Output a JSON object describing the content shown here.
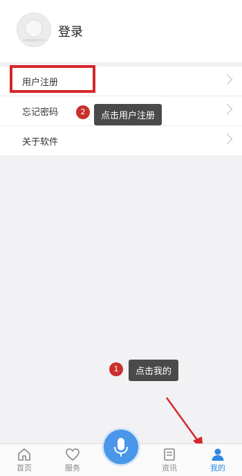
{
  "profile": {
    "login_label": "登录"
  },
  "menu": {
    "items": [
      {
        "label": "用户注册"
      },
      {
        "label": "忘记密码"
      },
      {
        "label": "关于软件"
      }
    ]
  },
  "annotations": {
    "step1": {
      "number": "1",
      "text": "点击我的"
    },
    "step2": {
      "number": "2",
      "text": "点击用户注册"
    }
  },
  "tabbar": {
    "tabs": [
      {
        "label": "首页",
        "icon": "home-icon"
      },
      {
        "label": "服务",
        "icon": "heart-icon"
      },
      {
        "label": "资讯",
        "icon": "document-icon"
      },
      {
        "label": "我的",
        "icon": "person-icon",
        "active": true
      }
    ],
    "voice_button": "microphone-icon"
  },
  "colors": {
    "accent": "#2f89e3",
    "highlight_red": "#d7262b",
    "badge_red": "#c9302c",
    "tooltip_bg": "#4a4a4a"
  }
}
